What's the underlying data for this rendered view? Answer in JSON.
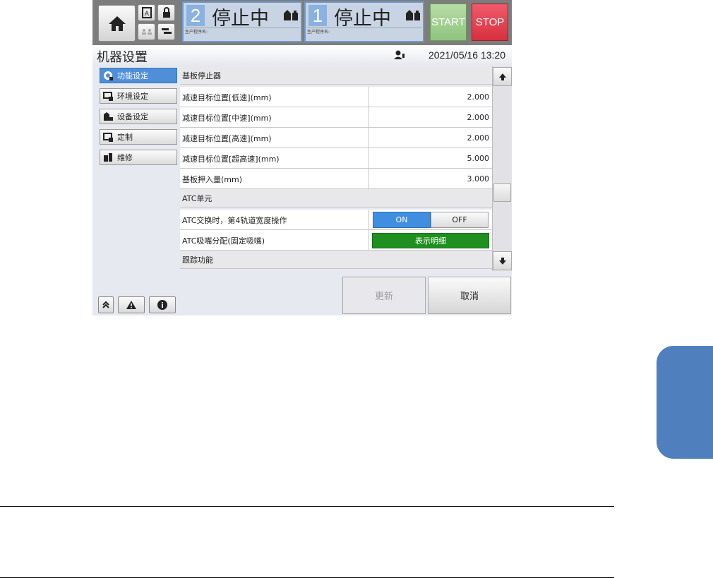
{
  "header": {
    "line2": {
      "number": "2",
      "status": "停止中",
      "program_label": "生产程序名:"
    },
    "line1": {
      "number": "1",
      "status": "停止中",
      "program_label": "生产程序名:"
    },
    "start_label": "START",
    "stop_label": "STOP"
  },
  "titlebar": {
    "title": "机器设置",
    "datetime": "2021/05/16 13:20"
  },
  "sidebar": {
    "items": [
      {
        "label": "功能设定",
        "icon": "function-settings-icon",
        "active": true
      },
      {
        "label": "环境设定",
        "icon": "environment-settings-icon",
        "active": false
      },
      {
        "label": "设备设定",
        "icon": "device-settings-icon",
        "active": false
      },
      {
        "label": "定制",
        "icon": "custom-icon",
        "active": false
      },
      {
        "label": "维修",
        "icon": "maintenance-icon",
        "active": false
      }
    ]
  },
  "content": {
    "sections": [
      {
        "header": "基板停止器",
        "rows": [
          {
            "label": "减速目标位置[低速](mm)",
            "value": "2.000"
          },
          {
            "label": "减速目标位置[中速](mm)",
            "value": "2.000"
          },
          {
            "label": "减速目标位置[高速](mm)",
            "value": "2.000"
          },
          {
            "label": "减速目标位置[超高速](mm)",
            "value": "5.000"
          },
          {
            "label": "基板押入量(mm)",
            "value": "3.000"
          }
        ]
      },
      {
        "header": "ATC单元",
        "rows": [
          {
            "label": "ATC交换时，第4轨道宽度操作",
            "toggle_on": "ON",
            "toggle_off": "OFF",
            "selected": "ON"
          },
          {
            "label": "ATC吸嘴分配(固定吸嘴)",
            "button": "表示明细"
          }
        ]
      },
      {
        "header": "跟踪功能",
        "rows": []
      }
    ]
  },
  "footer": {
    "update_label": "更新",
    "cancel_label": "取消"
  },
  "colors": {
    "accent": "#4f8fd8",
    "start": "#8fc47e",
    "stop": "#d8303f",
    "detail_button": "#1f8f1f",
    "page_tab": "#4f80bd"
  }
}
